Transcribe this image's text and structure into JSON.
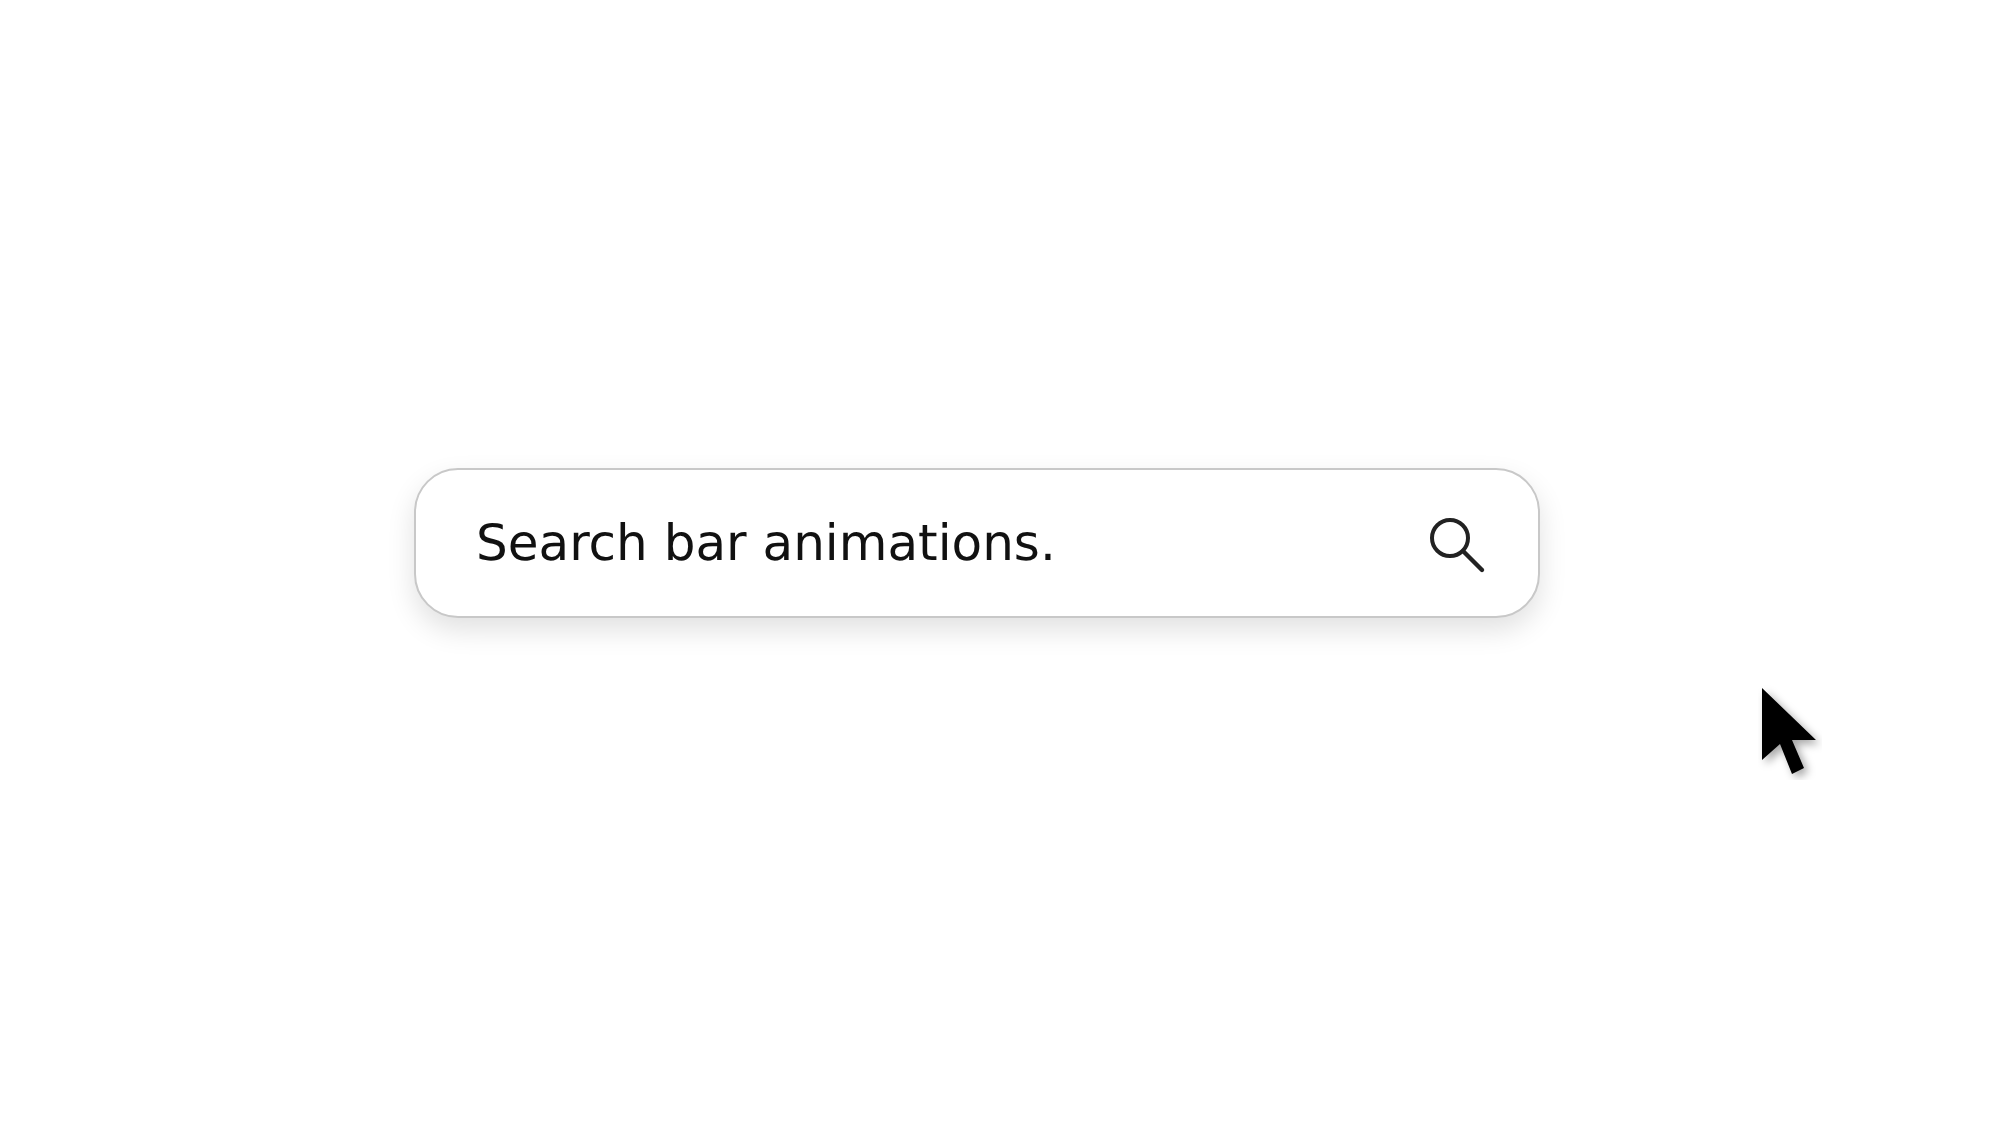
{
  "search": {
    "value": "Search bar animations."
  }
}
